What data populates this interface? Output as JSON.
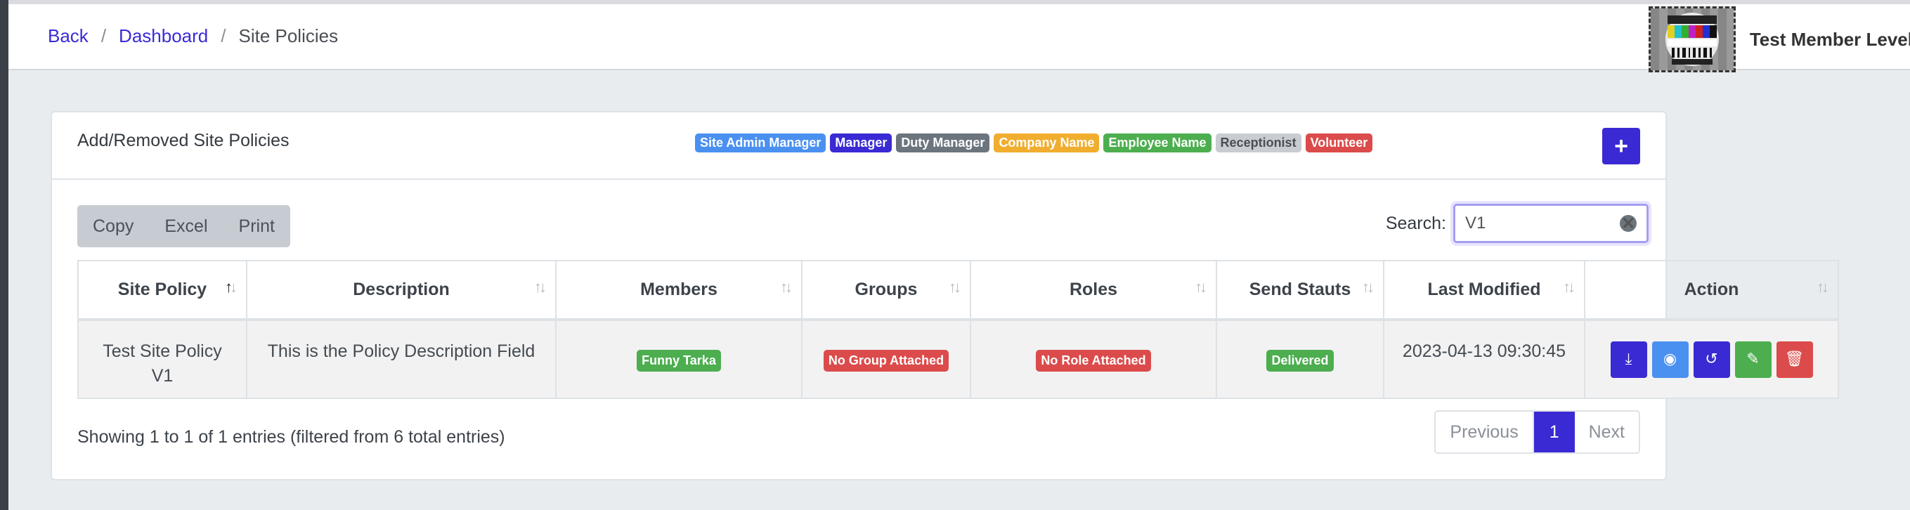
{
  "breadcrumb": {
    "back": "Back",
    "dashboard": "Dashboard",
    "current": "Site Policies",
    "sep": "/"
  },
  "user": {
    "name": "Test Member Level"
  },
  "card": {
    "title": "Add/Removed Site Policies",
    "legend": [
      {
        "label": "Site Admin Manager",
        "color": "#4a90f0",
        "text_color": "#ffffff"
      },
      {
        "label": "Manager",
        "color": "#3a2ad3",
        "text_color": "#ffffff"
      },
      {
        "label": "Duty Manager",
        "color": "#6c757d",
        "text_color": "#ffffff"
      },
      {
        "label": "Company Name",
        "color": "#f0ad2e",
        "text_color": "#ffffff"
      },
      {
        "label": "Employee Name",
        "color": "#4cae4f",
        "text_color": "#ffffff"
      },
      {
        "label": "Receptionist",
        "color": "#c9ccd0",
        "text_color": "#4a4f55"
      },
      {
        "label": "Volunteer",
        "color": "#dc4b4b",
        "text_color": "#ffffff"
      }
    ],
    "add_icon": "plus-icon",
    "add_symbol": "+"
  },
  "toolbar": {
    "copy": "Copy",
    "excel": "Excel",
    "print": "Print"
  },
  "search": {
    "label": "Search:",
    "value": "V1",
    "clear_symbol": "✕"
  },
  "table": {
    "headers": [
      "Site Policy",
      "Description",
      "Members",
      "Groups",
      "Roles",
      "Send Stauts",
      "Last Modified",
      "Action"
    ],
    "row": {
      "site_policy": "Test Site Policy V1",
      "description": "This is the Policy Description Field",
      "member": "Funny Tarka",
      "group": "No Group Attached",
      "role": "No Role Attached",
      "status": "Delivered",
      "last_modified": "2023-04-13 09:30:45"
    },
    "actions": [
      {
        "icon": "download-icon",
        "color": "#3a2ad3",
        "symbol": "⤓"
      },
      {
        "icon": "eye-icon",
        "color": "#4a90f0",
        "symbol": "◉"
      },
      {
        "icon": "history-icon",
        "color": "#3a2ad3",
        "symbol": "↺"
      },
      {
        "icon": "pencil-icon",
        "color": "#4cae4f",
        "symbol": "✎"
      },
      {
        "icon": "trash-icon",
        "color": "#dc4b4b",
        "symbol": "🗑"
      }
    ],
    "colors": {
      "green": "#4cae4f",
      "red": "#dc4b4b"
    }
  },
  "footer": {
    "info": "Showing 1 to 1 of 1 entries (filtered from 6 total entries)",
    "previous": "Previous",
    "page": "1",
    "next": "Next"
  }
}
